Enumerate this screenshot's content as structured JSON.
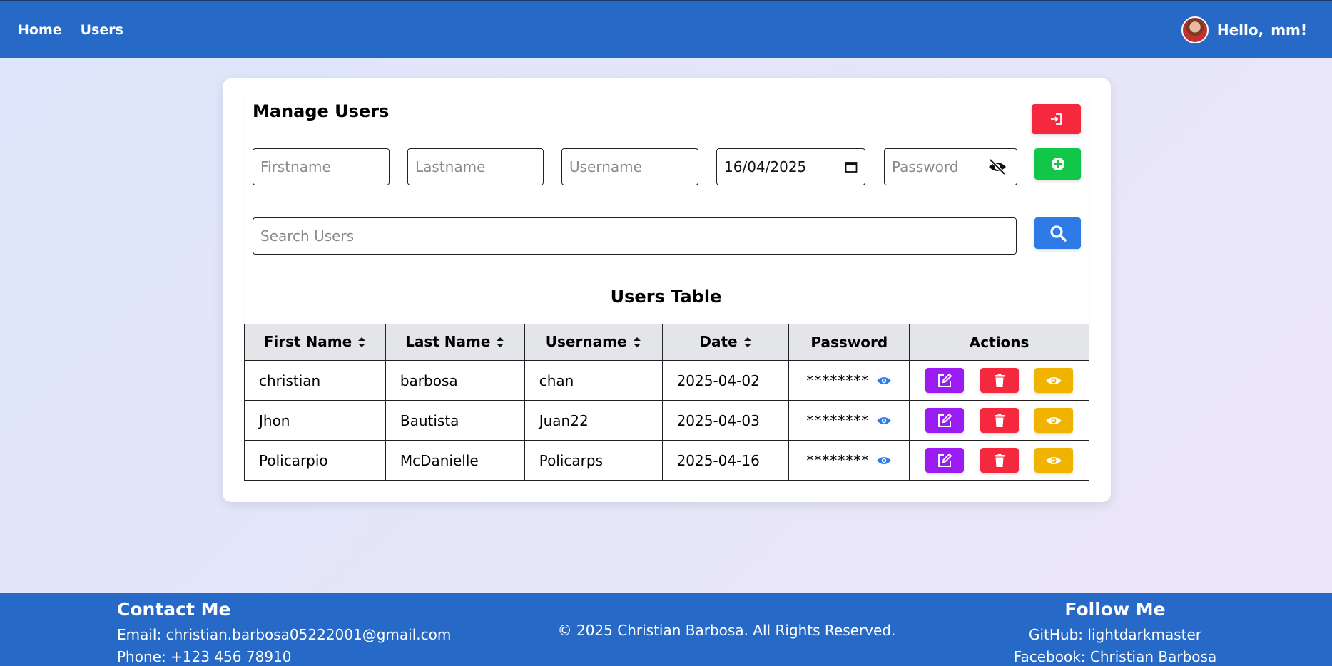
{
  "nav": {
    "links": [
      "Home",
      "Users"
    ],
    "greeting": "Hello,",
    "username": "mm!",
    "colors": {
      "bar": "#2669c6"
    }
  },
  "manage": {
    "title": "Manage Users",
    "firstname_placeholder": "Firstname",
    "lastname_placeholder": "Lastname",
    "username_placeholder": "Username",
    "date_value": "16/04/2025",
    "password_placeholder": "Password",
    "search_placeholder": "Search Users",
    "icons": {
      "logout": "logout-icon",
      "add": "plus-circle-icon",
      "search": "search-icon",
      "hide_password": "eye-slash-icon"
    },
    "colors": {
      "logout": "#f5283e",
      "add": "#12c64a",
      "search": "#2e7be8"
    }
  },
  "table": {
    "title": "Users Table",
    "headers": [
      "First Name",
      "Last Name",
      "Username",
      "Date",
      "Password",
      "Actions"
    ],
    "rows": [
      {
        "first": "christian",
        "last": "barbosa",
        "username": "chan",
        "date": "2025-04-02",
        "password": "********"
      },
      {
        "first": "Jhon",
        "last": "Bautista",
        "username": "Juan22",
        "date": "2025-04-03",
        "password": "********"
      },
      {
        "first": "Policarpio",
        "last": "McDanielle",
        "username": "Policarps",
        "date": "2025-04-16",
        "password": "********"
      }
    ],
    "action_colors": {
      "edit": "#9b1cf2",
      "delete": "#f5283e",
      "view": "#f0b400"
    }
  },
  "footer": {
    "contact_title": "Contact Me",
    "email": "Email: christian.barbosa05222001@gmail.com",
    "phone": "Phone: +123 456 78910",
    "copyright": "© 2025 Christian Barbosa. All Rights Reserved.",
    "follow_title": "Follow Me",
    "github": "GitHub: lightdarkmaster",
    "facebook": "Facebook: Christian Barbosa"
  }
}
